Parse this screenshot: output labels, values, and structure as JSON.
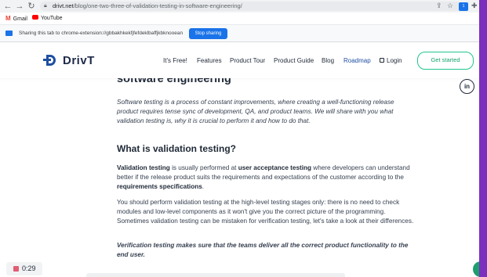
{
  "browser": {
    "url_host": "drivt.net",
    "url_path": "/blog/one-two-three-of-validation-testing-in-software-engineering/",
    "bookmarks": [
      {
        "label": "Gmail"
      },
      {
        "label": "YouTube"
      }
    ],
    "extension_badge": "1",
    "share_text": "Sharing this tab to chrome-extension://gbbakhkekfjfefdeklbaffjkbknooean",
    "stop_sharing_label": "Stop sharing"
  },
  "site": {
    "logo_text": "DrivT",
    "nav": [
      "It's Free!",
      "Features",
      "Product Tour",
      "Product Guide",
      "Blog",
      "Roadmap",
      "Login"
    ],
    "cta_label": "Get started",
    "linkedin_label": "in",
    "accent_green": "#22c58b",
    "brand_blue": "#1e4fa3"
  },
  "article": {
    "cut_heading": "software engineering",
    "intro": "Software testing is a process of constant improvements, where creating a well-functioning release product requires tense sync of development, QA, and product teams. We will share with you what validation testing is, why it is crucial to perform it and how to do that.",
    "h2": "What is validation testing?",
    "p1_a": "Validation testing",
    "p1_b": " is usually performed at ",
    "p1_c": "user acceptance testing",
    "p1_d": " where developers can understand better if the release product suits the requirements and expectations of the customer according to the ",
    "p1_e": "requirements specifications",
    "p1_f": ".",
    "p2": "You should perform validation testing at the high-level testing stages only: there is no need to check modules and low-level components as it won't give you the correct picture of the programming. Sometimes validation testing can be mistaken for verification testing, let's take a look at their differences.",
    "p3": "Verification testing makes sure that the teams deliver all the correct product functionality to the end user."
  },
  "recorder": {
    "time": "0:29"
  }
}
